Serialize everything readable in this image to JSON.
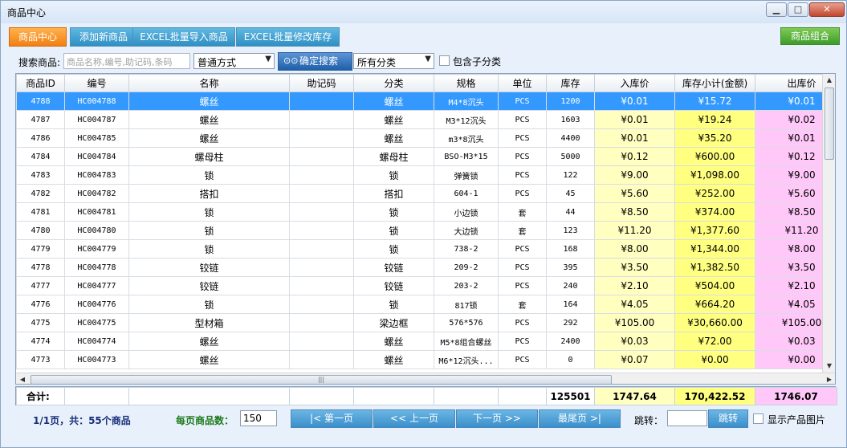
{
  "window": {
    "title": "商品中心"
  },
  "tabs": [
    {
      "label": "商品中心",
      "active": true
    },
    {
      "label": "添加新商品",
      "active": false
    },
    {
      "label": "EXCEL批量导入商品",
      "active": false
    },
    {
      "label": "EXCEL批量修改库存",
      "active": false
    }
  ],
  "group_button": "商品组合",
  "search": {
    "label": "搜索商品:",
    "placeholder": "商品名称,编号,助记码,条码",
    "mode": "普通方式",
    "button": "确定搜索",
    "category": "所有分类",
    "include_sub_label": "包含子分类",
    "include_sub": false
  },
  "columns": [
    "商品ID",
    "编号",
    "名称",
    "助记码",
    "分类",
    "规格",
    "单位",
    "库存",
    "入库价",
    "库存小计(金额)",
    "出库价"
  ],
  "rows": [
    {
      "id": "4788",
      "code": "HC004788",
      "name": "螺丝",
      "mnemonic": "",
      "category": "螺丝",
      "spec": "M4*8沉头",
      "unit": "PCS",
      "stock": "1200",
      "in_price": "¥0.01",
      "subtotal": "¥15.72",
      "out_price": "¥0.01",
      "selected": true
    },
    {
      "id": "4787",
      "code": "HC004787",
      "name": "螺丝",
      "mnemonic": "",
      "category": "螺丝",
      "spec": "M3*12沉头",
      "unit": "PCS",
      "stock": "1603",
      "in_price": "¥0.01",
      "subtotal": "¥19.24",
      "out_price": "¥0.02"
    },
    {
      "id": "4786",
      "code": "HC004785",
      "name": "螺丝",
      "mnemonic": "",
      "category": "螺丝",
      "spec": "m3*8沉头",
      "unit": "PCS",
      "stock": "4400",
      "in_price": "¥0.01",
      "subtotal": "¥35.20",
      "out_price": "¥0.01"
    },
    {
      "id": "4784",
      "code": "HC004784",
      "name": "螺母柱",
      "mnemonic": "",
      "category": "螺母柱",
      "spec": "BSO-M3*15",
      "unit": "PCS",
      "stock": "5000",
      "in_price": "¥0.12",
      "subtotal": "¥600.00",
      "out_price": "¥0.12"
    },
    {
      "id": "4783",
      "code": "HC004783",
      "name": "锁",
      "mnemonic": "",
      "category": "锁",
      "spec": "弹簧锁",
      "unit": "PCS",
      "stock": "122",
      "in_price": "¥9.00",
      "subtotal": "¥1,098.00",
      "out_price": "¥9.00"
    },
    {
      "id": "4782",
      "code": "HC004782",
      "name": "搭扣",
      "mnemonic": "",
      "category": "搭扣",
      "spec": "604-1",
      "unit": "PCS",
      "stock": "45",
      "in_price": "¥5.60",
      "subtotal": "¥252.00",
      "out_price": "¥5.60"
    },
    {
      "id": "4781",
      "code": "HC004781",
      "name": "锁",
      "mnemonic": "",
      "category": "锁",
      "spec": "小边锁",
      "unit": "套",
      "stock": "44",
      "in_price": "¥8.50",
      "subtotal": "¥374.00",
      "out_price": "¥8.50"
    },
    {
      "id": "4780",
      "code": "HC004780",
      "name": "锁",
      "mnemonic": "",
      "category": "锁",
      "spec": "大边锁",
      "unit": "套",
      "stock": "123",
      "in_price": "¥11.20",
      "subtotal": "¥1,377.60",
      "out_price": "¥11.20"
    },
    {
      "id": "4779",
      "code": "HC004779",
      "name": "锁",
      "mnemonic": "",
      "category": "锁",
      "spec": "738-2",
      "unit": "PCS",
      "stock": "168",
      "in_price": "¥8.00",
      "subtotal": "¥1,344.00",
      "out_price": "¥8.00"
    },
    {
      "id": "4778",
      "code": "HC004778",
      "name": "铰链",
      "mnemonic": "",
      "category": "铰链",
      "spec": "209-2",
      "unit": "PCS",
      "stock": "395",
      "in_price": "¥3.50",
      "subtotal": "¥1,382.50",
      "out_price": "¥3.50"
    },
    {
      "id": "4777",
      "code": "HC004777",
      "name": "铰链",
      "mnemonic": "",
      "category": "铰链",
      "spec": "203-2",
      "unit": "PCS",
      "stock": "240",
      "in_price": "¥2.10",
      "subtotal": "¥504.00",
      "out_price": "¥2.10"
    },
    {
      "id": "4776",
      "code": "HC004776",
      "name": "锁",
      "mnemonic": "",
      "category": "锁",
      "spec": "817锁",
      "unit": "套",
      "stock": "164",
      "in_price": "¥4.05",
      "subtotal": "¥664.20",
      "out_price": "¥4.05"
    },
    {
      "id": "4775",
      "code": "HC004775",
      "name": "型材箱",
      "mnemonic": "",
      "category": "梁边框",
      "spec": "576*576",
      "unit": "PCS",
      "stock": "292",
      "in_price": "¥105.00",
      "subtotal": "¥30,660.00",
      "out_price": "¥105.00"
    },
    {
      "id": "4774",
      "code": "HC004774",
      "name": "螺丝",
      "mnemonic": "",
      "category": "螺丝",
      "spec": "M5*8组合螺丝",
      "unit": "PCS",
      "stock": "2400",
      "in_price": "¥0.03",
      "subtotal": "¥72.00",
      "out_price": "¥0.03"
    },
    {
      "id": "4773",
      "code": "HC004773",
      "name": "螺丝",
      "mnemonic": "",
      "category": "螺丝",
      "spec": "M6*12沉头...",
      "unit": "PCS",
      "stock": "0",
      "in_price": "¥0.07",
      "subtotal": "¥0.00",
      "out_price": "¥0.00"
    }
  ],
  "totals": {
    "label": "合计:",
    "stock": "125501",
    "in_price": "1747.64",
    "subtotal": "170,422.52",
    "out_price": "1746.07"
  },
  "footer": {
    "page_info": "1/1页，共：55个商品",
    "per_page_label": "每页商品数：",
    "per_page": "150",
    "first": "|< 第一页",
    "prev": "<< 上一页",
    "next": "下一页 >>",
    "last": "最尾页 >|",
    "jump_label": "跳转：",
    "jump_button": "跳转",
    "show_images_label": "显示产品图片",
    "show_images": false
  },
  "colors": {
    "selected_row": "#3399ff",
    "in_price_bg": "#ffffc0",
    "subtotal_bg": "#ffff80",
    "out_price_bg": "#ffc8f8",
    "tab_active": "#f27f12",
    "tab": "#2f8fc4",
    "group_button": "#3d9c28"
  }
}
